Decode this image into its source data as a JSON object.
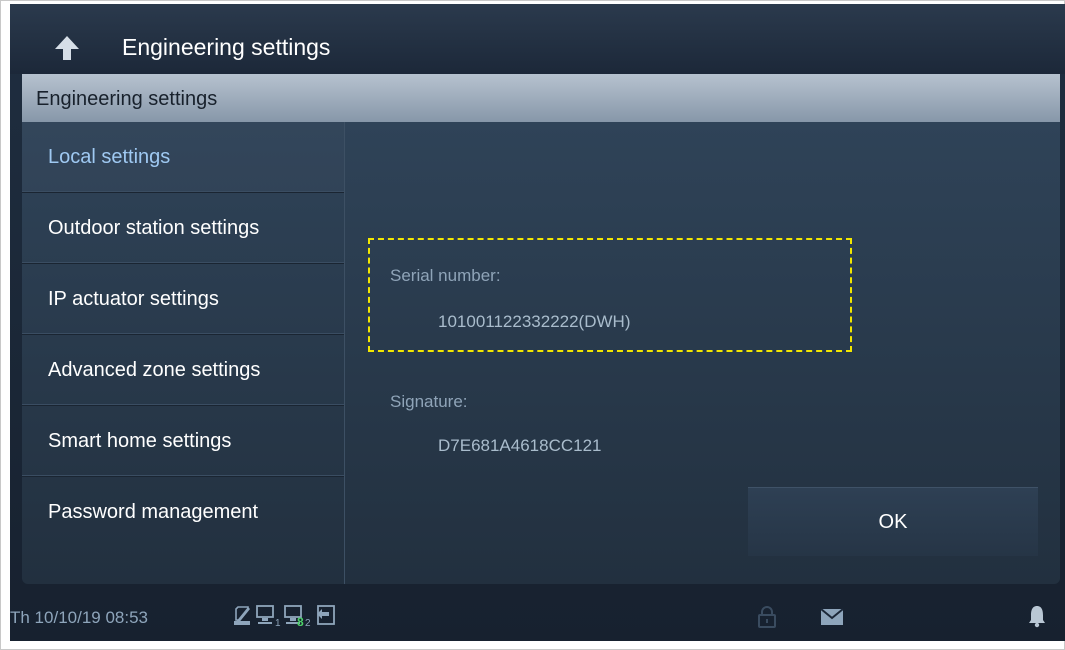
{
  "header": {
    "title": "Engineering settings",
    "back_icon": "back-arrow-icon"
  },
  "section": {
    "title": "Engineering settings"
  },
  "sidebar": {
    "items": [
      {
        "label": "Local settings",
        "active": true
      },
      {
        "label": "Outdoor station settings",
        "active": false
      },
      {
        "label": "IP actuator settings",
        "active": false
      },
      {
        "label": "Advanced zone settings",
        "active": false
      },
      {
        "label": "Smart home settings",
        "active": false
      },
      {
        "label": "Password management",
        "active": false
      }
    ]
  },
  "content": {
    "serial_label": "Serial number:",
    "serial_value": "101001122332222(DWH)",
    "signature_label": "Signature:",
    "signature_value": "D7E681A4618CC121",
    "ok_label": "OK"
  },
  "statusbar": {
    "datetime": "Th 10/10/19  08:53",
    "icons": [
      "sd-card-icon",
      "monitor-1-icon",
      "monitor-2-icon",
      "exit-icon",
      "lock-icon",
      "mail-icon",
      "bell-icon"
    ],
    "monitor1_sub": "1",
    "monitor2_sub": "2",
    "monitor2_badge": "8"
  },
  "colors": {
    "highlight": "#f2e600",
    "active_text": "#9fc9f2",
    "badge": "#4ed36a"
  }
}
